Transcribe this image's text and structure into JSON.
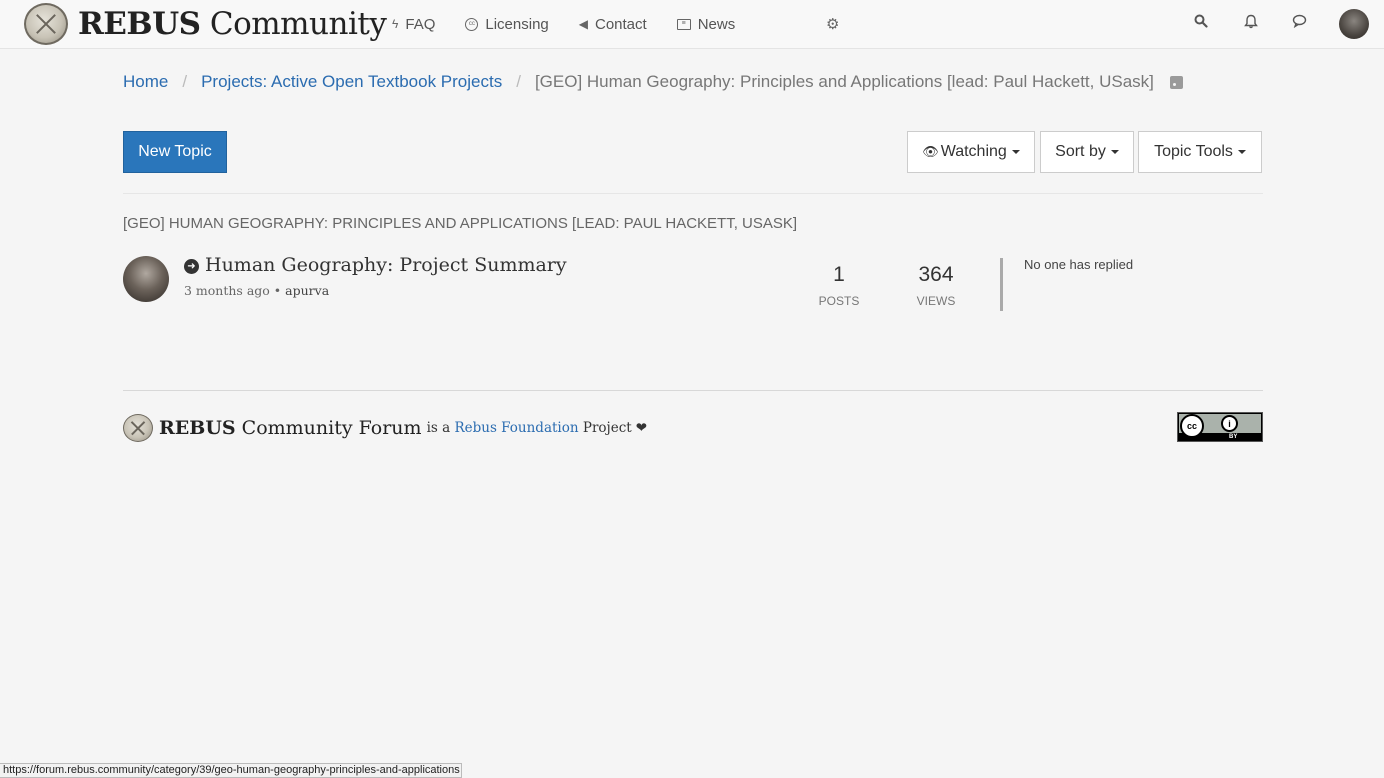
{
  "navbar": {
    "brand_bold": "REBUS",
    "brand_rest": " Community",
    "links": [
      {
        "label": "FAQ",
        "icon": "bolt-icon"
      },
      {
        "label": "Licensing",
        "icon": "cc-icon"
      },
      {
        "label": "Contact",
        "icon": "bullhorn-icon"
      },
      {
        "label": "News",
        "icon": "newspaper-icon"
      }
    ],
    "right_icons": [
      "search-icon",
      "bell-icon",
      "chat-icon",
      "avatar"
    ]
  },
  "breadcrumb": {
    "home": "Home",
    "parent": "Projects: Active Open Textbook Projects",
    "current": "[GEO] Human Geography: Principles and Applications [lead: Paul Hackett, USask]",
    "separator": "/"
  },
  "toolbar": {
    "new_topic": "New Topic",
    "watching": "Watching",
    "sort_by": "Sort by",
    "topic_tools": "Topic Tools"
  },
  "category": {
    "title": "[GEO] Human Geography: Principles and Applications [lead: Paul Hackett, USask]"
  },
  "topics": [
    {
      "title": "Human Geography: Project Summary",
      "time": "3 months ago",
      "dot": "•",
      "author": "apurva",
      "posts": "1",
      "posts_label": "Posts",
      "views": "364",
      "views_label": "Views",
      "teaser": "No one has replied"
    }
  ],
  "footer": {
    "brand_bold": "REBUS",
    "brand_rest": " Community Forum",
    "text_before": "is a ",
    "link": "Rebus Foundation",
    "text_after": " Project",
    "heart": "❤",
    "cc_label": "cc",
    "by_label": "BY"
  },
  "status_url": "https://forum.rebus.community/category/39/geo-human-geography-principles-and-applications"
}
